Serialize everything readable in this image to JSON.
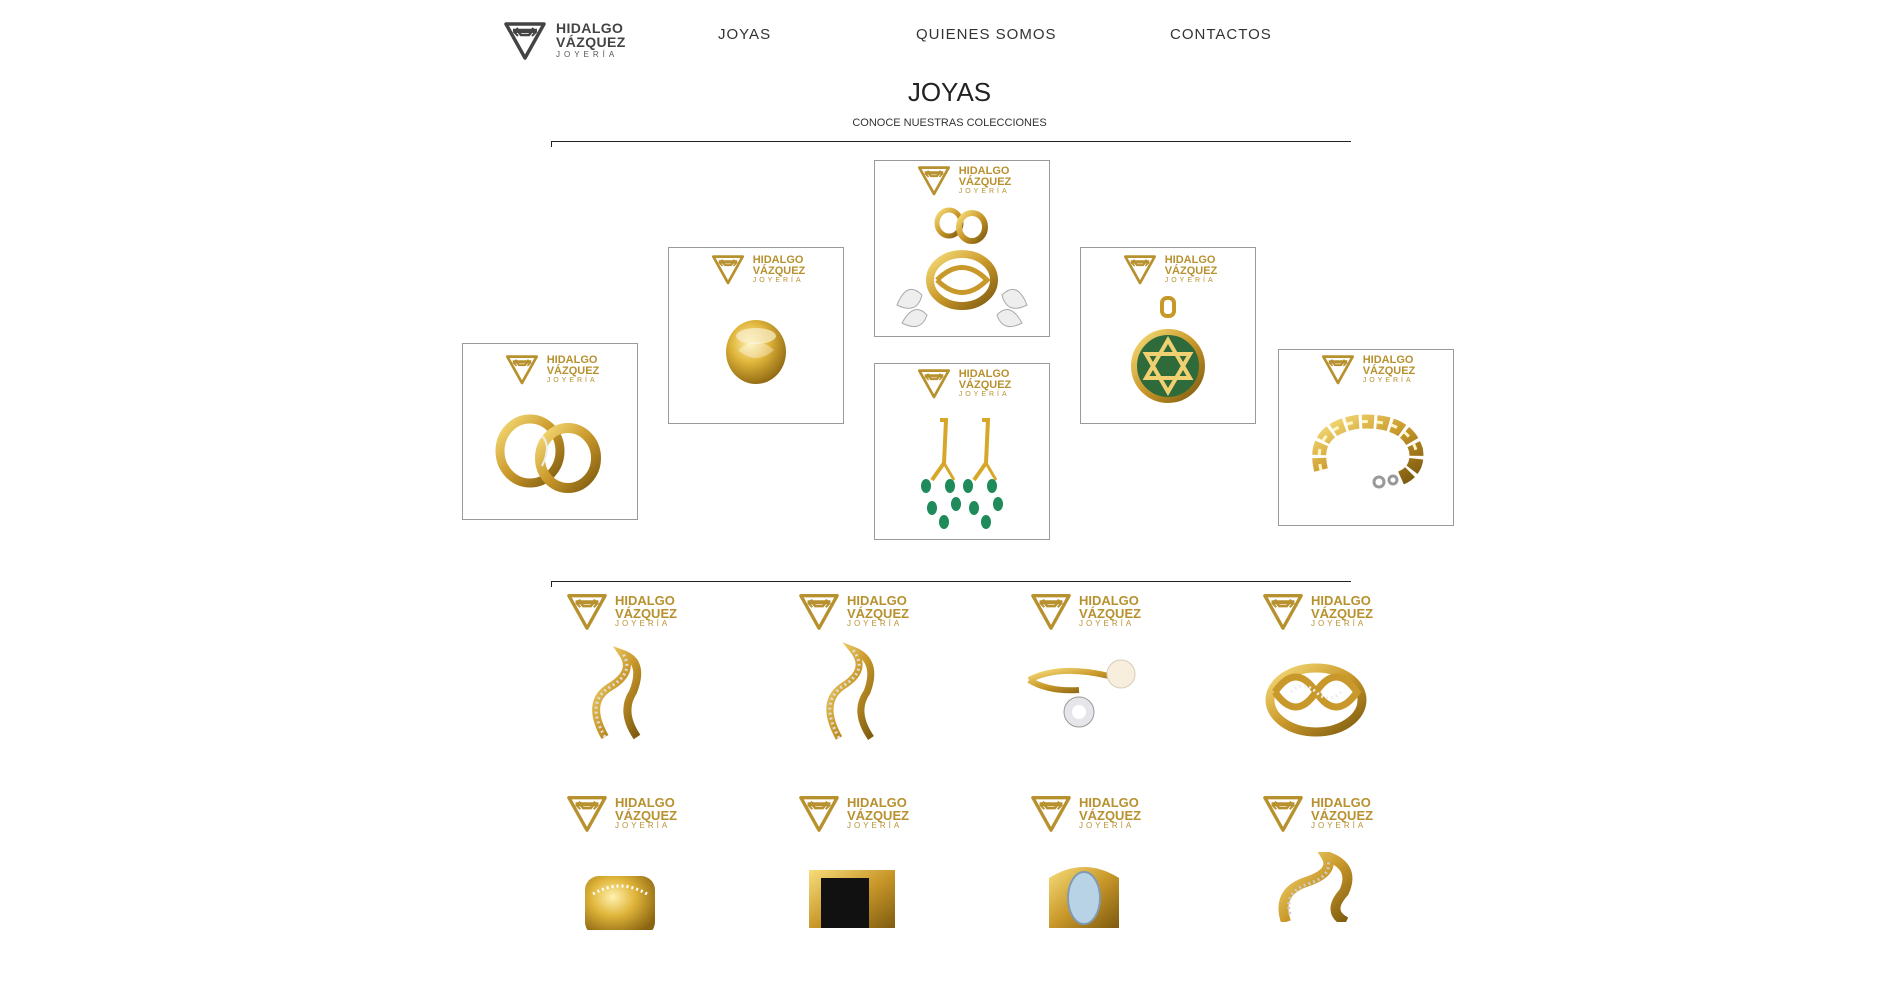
{
  "header": {
    "brand_line1": "HIDALGO",
    "brand_line2": "VÁZQUEZ",
    "brand_line3": "JOYERÍA",
    "nav": [
      "JOYAS",
      "QUIENES SOMOS",
      "CONTACTOS"
    ]
  },
  "page": {
    "title": "JOYAS",
    "subtitle": "CONOCE NUESTRAS COLECCIONES"
  },
  "watermark": {
    "line1": "HIDALGO",
    "line2": "VÁZQUEZ",
    "line3": "JOYERÍA"
  },
  "colors": {
    "gold": "#b8912f",
    "text": "#222222",
    "border": "#9a9a9a"
  },
  "featured": [
    {
      "id": "rings-pair",
      "icon": "wedding-rings-icon"
    },
    {
      "id": "dome-ring",
      "icon": "dome-ring-icon"
    },
    {
      "id": "set",
      "icon": "jewelry-set-icon"
    },
    {
      "id": "earrings",
      "icon": "emerald-earrings-icon"
    },
    {
      "id": "star-pendant",
      "icon": "star-pendant-icon"
    },
    {
      "id": "bracelet",
      "icon": "gold-bracelet-icon"
    }
  ],
  "products": [
    {
      "id": "p1",
      "icon": "swirl-ring-icon"
    },
    {
      "id": "p2",
      "icon": "swirl-ring-icon"
    },
    {
      "id": "p3",
      "icon": "pearl-ring-icon"
    },
    {
      "id": "p4",
      "icon": "infinity-ring-icon"
    },
    {
      "id": "p5",
      "icon": "wide-ring-icon"
    },
    {
      "id": "p6",
      "icon": "onyx-ring-icon"
    },
    {
      "id": "p7",
      "icon": "topaz-ring-icon"
    },
    {
      "id": "p8",
      "icon": "swirl-ring-icon"
    }
  ]
}
